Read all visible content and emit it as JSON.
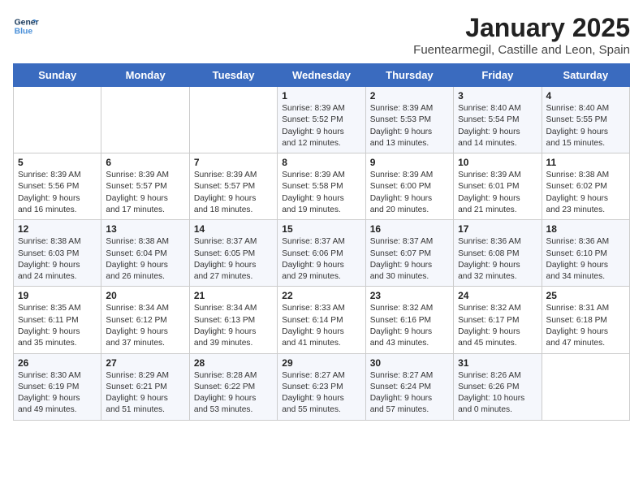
{
  "header": {
    "logo_line1": "General",
    "logo_line2": "Blue",
    "title": "January 2025",
    "subtitle": "Fuentearmegil, Castille and Leon, Spain"
  },
  "weekdays": [
    "Sunday",
    "Monday",
    "Tuesday",
    "Wednesday",
    "Thursday",
    "Friday",
    "Saturday"
  ],
  "weeks": [
    [
      {
        "day": "",
        "content": ""
      },
      {
        "day": "",
        "content": ""
      },
      {
        "day": "",
        "content": ""
      },
      {
        "day": "1",
        "content": "Sunrise: 8:39 AM\nSunset: 5:52 PM\nDaylight: 9 hours\nand 12 minutes."
      },
      {
        "day": "2",
        "content": "Sunrise: 8:39 AM\nSunset: 5:53 PM\nDaylight: 9 hours\nand 13 minutes."
      },
      {
        "day": "3",
        "content": "Sunrise: 8:40 AM\nSunset: 5:54 PM\nDaylight: 9 hours\nand 14 minutes."
      },
      {
        "day": "4",
        "content": "Sunrise: 8:40 AM\nSunset: 5:55 PM\nDaylight: 9 hours\nand 15 minutes."
      }
    ],
    [
      {
        "day": "5",
        "content": "Sunrise: 8:39 AM\nSunset: 5:56 PM\nDaylight: 9 hours\nand 16 minutes."
      },
      {
        "day": "6",
        "content": "Sunrise: 8:39 AM\nSunset: 5:57 PM\nDaylight: 9 hours\nand 17 minutes."
      },
      {
        "day": "7",
        "content": "Sunrise: 8:39 AM\nSunset: 5:57 PM\nDaylight: 9 hours\nand 18 minutes."
      },
      {
        "day": "8",
        "content": "Sunrise: 8:39 AM\nSunset: 5:58 PM\nDaylight: 9 hours\nand 19 minutes."
      },
      {
        "day": "9",
        "content": "Sunrise: 8:39 AM\nSunset: 6:00 PM\nDaylight: 9 hours\nand 20 minutes."
      },
      {
        "day": "10",
        "content": "Sunrise: 8:39 AM\nSunset: 6:01 PM\nDaylight: 9 hours\nand 21 minutes."
      },
      {
        "day": "11",
        "content": "Sunrise: 8:38 AM\nSunset: 6:02 PM\nDaylight: 9 hours\nand 23 minutes."
      }
    ],
    [
      {
        "day": "12",
        "content": "Sunrise: 8:38 AM\nSunset: 6:03 PM\nDaylight: 9 hours\nand 24 minutes."
      },
      {
        "day": "13",
        "content": "Sunrise: 8:38 AM\nSunset: 6:04 PM\nDaylight: 9 hours\nand 26 minutes."
      },
      {
        "day": "14",
        "content": "Sunrise: 8:37 AM\nSunset: 6:05 PM\nDaylight: 9 hours\nand 27 minutes."
      },
      {
        "day": "15",
        "content": "Sunrise: 8:37 AM\nSunset: 6:06 PM\nDaylight: 9 hours\nand 29 minutes."
      },
      {
        "day": "16",
        "content": "Sunrise: 8:37 AM\nSunset: 6:07 PM\nDaylight: 9 hours\nand 30 minutes."
      },
      {
        "day": "17",
        "content": "Sunrise: 8:36 AM\nSunset: 6:08 PM\nDaylight: 9 hours\nand 32 minutes."
      },
      {
        "day": "18",
        "content": "Sunrise: 8:36 AM\nSunset: 6:10 PM\nDaylight: 9 hours\nand 34 minutes."
      }
    ],
    [
      {
        "day": "19",
        "content": "Sunrise: 8:35 AM\nSunset: 6:11 PM\nDaylight: 9 hours\nand 35 minutes."
      },
      {
        "day": "20",
        "content": "Sunrise: 8:34 AM\nSunset: 6:12 PM\nDaylight: 9 hours\nand 37 minutes."
      },
      {
        "day": "21",
        "content": "Sunrise: 8:34 AM\nSunset: 6:13 PM\nDaylight: 9 hours\nand 39 minutes."
      },
      {
        "day": "22",
        "content": "Sunrise: 8:33 AM\nSunset: 6:14 PM\nDaylight: 9 hours\nand 41 minutes."
      },
      {
        "day": "23",
        "content": "Sunrise: 8:32 AM\nSunset: 6:16 PM\nDaylight: 9 hours\nand 43 minutes."
      },
      {
        "day": "24",
        "content": "Sunrise: 8:32 AM\nSunset: 6:17 PM\nDaylight: 9 hours\nand 45 minutes."
      },
      {
        "day": "25",
        "content": "Sunrise: 8:31 AM\nSunset: 6:18 PM\nDaylight: 9 hours\nand 47 minutes."
      }
    ],
    [
      {
        "day": "26",
        "content": "Sunrise: 8:30 AM\nSunset: 6:19 PM\nDaylight: 9 hours\nand 49 minutes."
      },
      {
        "day": "27",
        "content": "Sunrise: 8:29 AM\nSunset: 6:21 PM\nDaylight: 9 hours\nand 51 minutes."
      },
      {
        "day": "28",
        "content": "Sunrise: 8:28 AM\nSunset: 6:22 PM\nDaylight: 9 hours\nand 53 minutes."
      },
      {
        "day": "29",
        "content": "Sunrise: 8:27 AM\nSunset: 6:23 PM\nDaylight: 9 hours\nand 55 minutes."
      },
      {
        "day": "30",
        "content": "Sunrise: 8:27 AM\nSunset: 6:24 PM\nDaylight: 9 hours\nand 57 minutes."
      },
      {
        "day": "31",
        "content": "Sunrise: 8:26 AM\nSunset: 6:26 PM\nDaylight: 10 hours\nand 0 minutes."
      },
      {
        "day": "",
        "content": ""
      }
    ]
  ]
}
